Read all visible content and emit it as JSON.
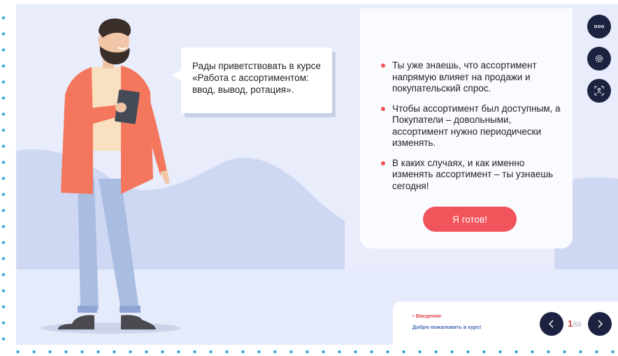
{
  "bubble": {
    "text": "Рады приветствовать в курсе «Работа с ассортиментом: ввод, вывод, ротация»."
  },
  "card": {
    "bullets": [
      "Ты уже знаешь, что ассортимент напрямую влияет на продажи и покупательский спрос.",
      "Чтобы ассортимент был доступным, а Покупатели – довольными, ассортимент нужно периодически изменять.",
      "В каких случаях, и как именно изменять ассортимент – ты узнаешь сегодня!"
    ],
    "button_label": "Я готов!"
  },
  "side_buttons": {
    "menu_icon": "more-dots-icon",
    "settings_icon": "gear-icon",
    "accessibility_icon": "accessibility-icon"
  },
  "nav": {
    "section": "Введение",
    "subtitle": "Добро пожаловать в курс!",
    "current_page": "1",
    "total_pages": "/55",
    "prev_icon": "chevron-left-icon",
    "next_icon": "chevron-right-icon"
  },
  "colors": {
    "accent": "#f2545b",
    "dark": "#1c2340",
    "background": "#e8ecfb",
    "dots": "#2ea4d6"
  }
}
